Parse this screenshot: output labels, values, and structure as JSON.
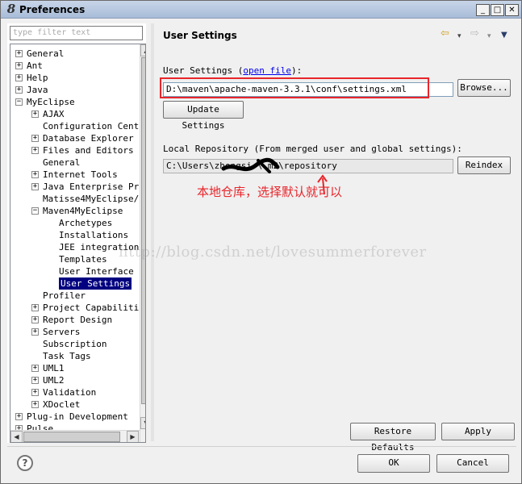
{
  "window": {
    "icon": "eclipse-icon",
    "title": "Preferences",
    "minimize": "_",
    "maximize": "□",
    "close": "✕"
  },
  "filter": {
    "placeholder": "type filter text"
  },
  "tree": [
    {
      "label": "General",
      "toggle": "+"
    },
    {
      "label": "Ant",
      "toggle": "+"
    },
    {
      "label": "Help",
      "toggle": "+"
    },
    {
      "label": "Java",
      "toggle": "+"
    },
    {
      "label": "MyEclipse",
      "toggle": "−"
    },
    {
      "label": "AJAX",
      "toggle": "+"
    },
    {
      "label": "Configuration Cent",
      "toggle": ""
    },
    {
      "label": "Database Explorer",
      "toggle": "+"
    },
    {
      "label": "Files and Editors",
      "toggle": "+"
    },
    {
      "label": "General",
      "toggle": ""
    },
    {
      "label": "Internet Tools",
      "toggle": "+"
    },
    {
      "label": "Java Enterprise Pr",
      "toggle": "+"
    },
    {
      "label": "Matisse4MyEclipse/",
      "toggle": ""
    },
    {
      "label": "Maven4MyEclipse",
      "toggle": "−"
    },
    {
      "label": "Archetypes",
      "toggle": ""
    },
    {
      "label": "Installations",
      "toggle": ""
    },
    {
      "label": "JEE integration",
      "toggle": ""
    },
    {
      "label": "Templates",
      "toggle": ""
    },
    {
      "label": "User Interface",
      "toggle": ""
    },
    {
      "label": "User Settings",
      "toggle": "",
      "selected": true
    },
    {
      "label": "Profiler",
      "toggle": ""
    },
    {
      "label": "Project Capabiliti",
      "toggle": "+"
    },
    {
      "label": "Report Design",
      "toggle": "+"
    },
    {
      "label": "Servers",
      "toggle": "+"
    },
    {
      "label": "Subscription",
      "toggle": ""
    },
    {
      "label": "Task Tags",
      "toggle": ""
    },
    {
      "label": "UML1",
      "toggle": "+"
    },
    {
      "label": "UML2",
      "toggle": "+"
    },
    {
      "label": "Validation",
      "toggle": "+"
    },
    {
      "label": "XDoclet",
      "toggle": "+"
    },
    {
      "label": "Plug-in Development",
      "toggle": "+"
    },
    {
      "label": "Pulse",
      "toggle": "+"
    }
  ],
  "page": {
    "title": "User Settings",
    "nav": {
      "back": "⇦",
      "back_menu": "▾",
      "forward": "⇨",
      "forward_menu": "▾",
      "view_menu": "▼"
    },
    "user_settings_label": "User Settings (",
    "user_settings_link": "open file",
    "user_settings_suffix": "):",
    "user_settings_value": "D:\\maven\\apache-maven-3.3.1\\conf\\settings.xml",
    "browse": "Browse...",
    "update_settings": "Update Settings",
    "local_repo_label": "Local Repository (From merged user and global settings):",
    "local_repo_value": "C:\\Users\\zhengsi  \\.m2\\repository",
    "reindex": "Reindex",
    "annotation": "本地仓库，选择默认就可以",
    "watermark": "http://blog.csdn.net/lovesummerforever",
    "restore_defaults": "Restore Defaults",
    "apply": "Apply"
  },
  "footer": {
    "help": "?",
    "ok": "OK",
    "cancel": "Cancel"
  }
}
